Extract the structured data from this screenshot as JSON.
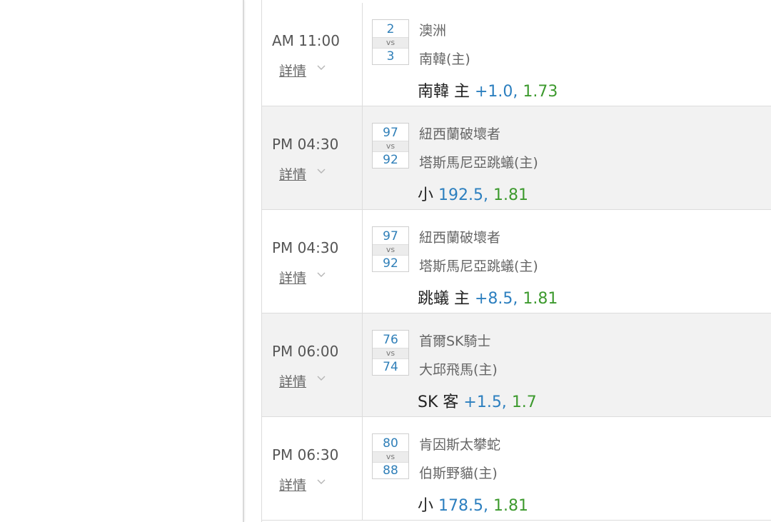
{
  "detail_label": "詳情",
  "matches": [
    {
      "time": "AM 11:00",
      "score_away": "2",
      "vs": "vs",
      "score_home": "3",
      "team_away": "澳洲",
      "team_home": "南韓(主)",
      "pick": "南韓 主",
      "line": "+1.0,",
      "odds": "1.73"
    },
    {
      "time": "PM 04:30",
      "score_away": "97",
      "vs": "vs",
      "score_home": "92",
      "team_away": "紐西蘭破壞者",
      "team_home": "塔斯馬尼亞跳蟻(主)",
      "pick": "小",
      "line": "192.5,",
      "odds": "1.81"
    },
    {
      "time": "PM 04:30",
      "score_away": "97",
      "vs": "vs",
      "score_home": "92",
      "team_away": "紐西蘭破壞者",
      "team_home": "塔斯馬尼亞跳蟻(主)",
      "pick": "跳蟻 主",
      "line": "+8.5,",
      "odds": "1.81"
    },
    {
      "time": "PM 06:00",
      "score_away": "76",
      "vs": "vs",
      "score_home": "74",
      "team_away": "首爾SK騎士",
      "team_home": "大邱飛馬(主)",
      "pick": "SK 客",
      "line": "+1.5,",
      "odds": "1.7"
    },
    {
      "time": "PM 06:30",
      "score_away": "80",
      "vs": "vs",
      "score_home": "88",
      "team_away": "肯因斯太攀蛇",
      "team_home": "伯斯野貓(主)",
      "pick": "小",
      "line": "178.5,",
      "odds": "1.81"
    }
  ],
  "colors": {
    "score": "#2f7fb8",
    "line": "#2c7fbf",
    "odds": "#3d9a2e",
    "alt_row": "#f2f2f2"
  },
  "icons": {
    "detail_toggle": "chevron-down-icon"
  }
}
